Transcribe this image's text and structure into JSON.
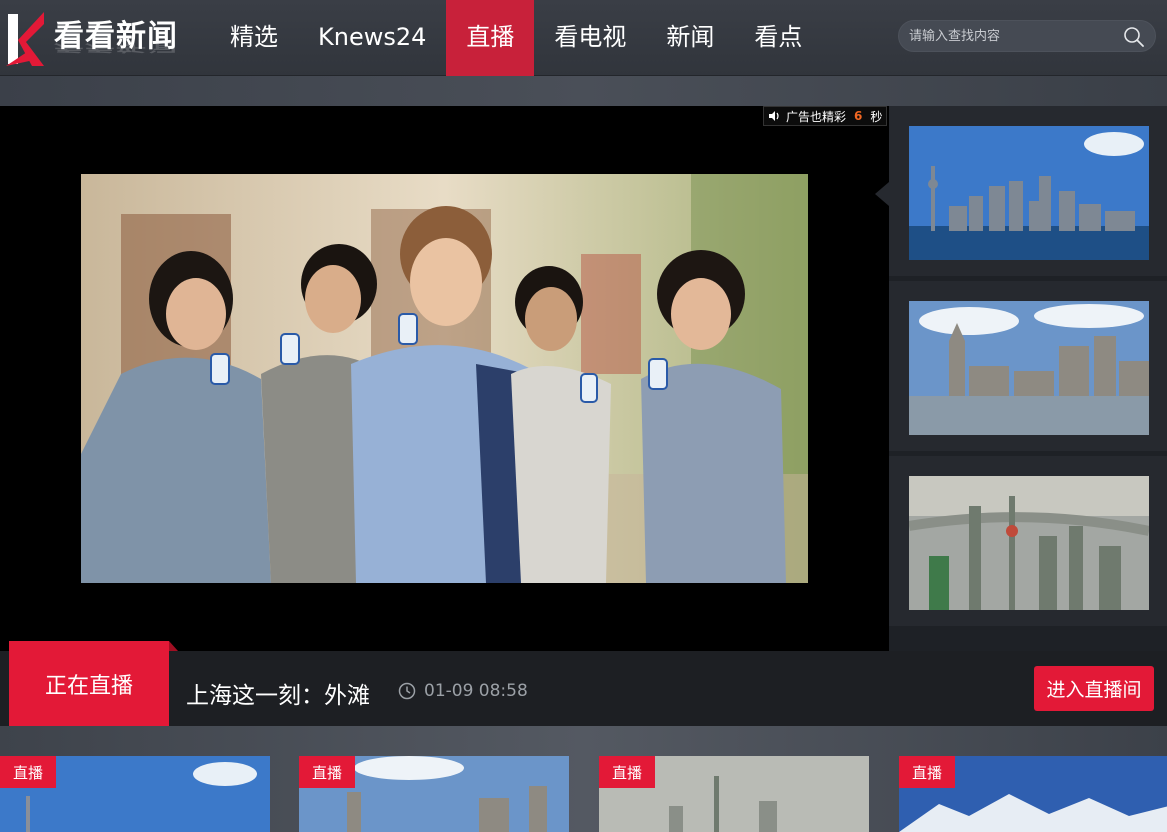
{
  "header": {
    "logo_text": "看看新闻",
    "nav": [
      {
        "label": "精选",
        "active": false
      },
      {
        "label": "Knews24",
        "active": false
      },
      {
        "label": "直播",
        "active": true
      },
      {
        "label": "看电视",
        "active": false
      },
      {
        "label": "新闻",
        "active": false
      },
      {
        "label": "看点",
        "active": false
      }
    ],
    "search": {
      "placeholder": "请输入查找内容",
      "icon": "search-icon"
    }
  },
  "player": {
    "ad": {
      "label": "广告也精彩",
      "countdown": "6",
      "unit": "秒",
      "icon": "speaker-icon"
    }
  },
  "side_list": [
    {
      "name": "pudong-skyline-thumb"
    },
    {
      "name": "bund-waterfront-thumb"
    },
    {
      "name": "aerial-lujiazui-thumb"
    }
  ],
  "live": {
    "tag": "正在直播",
    "title": "上海这一刻：外滩",
    "time": "01-09 08:58",
    "enter_button": "进入直播间"
  },
  "cards": [
    {
      "tag": "直播"
    },
    {
      "tag": "直播"
    },
    {
      "tag": "直播"
    },
    {
      "tag": "直播"
    }
  ],
  "colors": {
    "accent": "#e31937",
    "header_bg": "#3a3e46",
    "ad_count": "#f26722"
  }
}
